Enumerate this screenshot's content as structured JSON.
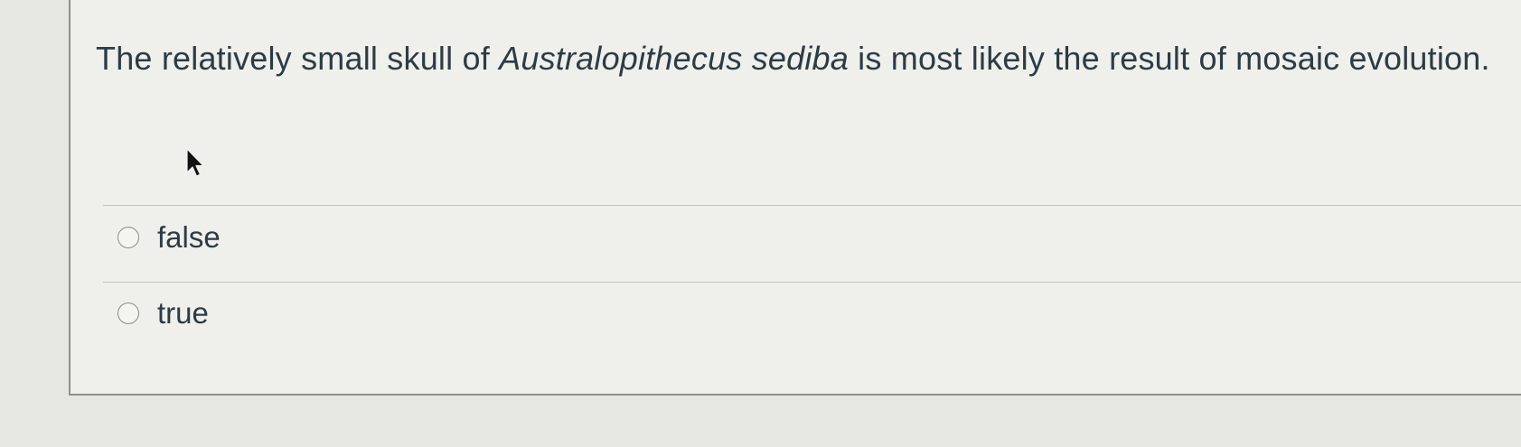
{
  "question": {
    "text_before": "The relatively small skull of ",
    "text_italic": "Australopithecus sediba",
    "text_after": " is most likely the result of mosaic evolution."
  },
  "answers": [
    {
      "label": "false",
      "selected": false
    },
    {
      "label": "true",
      "selected": false
    }
  ],
  "icons": {
    "cursor": "mouse-pointer-icon",
    "radio": "radio-button"
  },
  "colors": {
    "text": "#2d3b45",
    "card_background": "#efefeb",
    "page_background": "#e6e6e2",
    "border": "#8f8f8b"
  }
}
